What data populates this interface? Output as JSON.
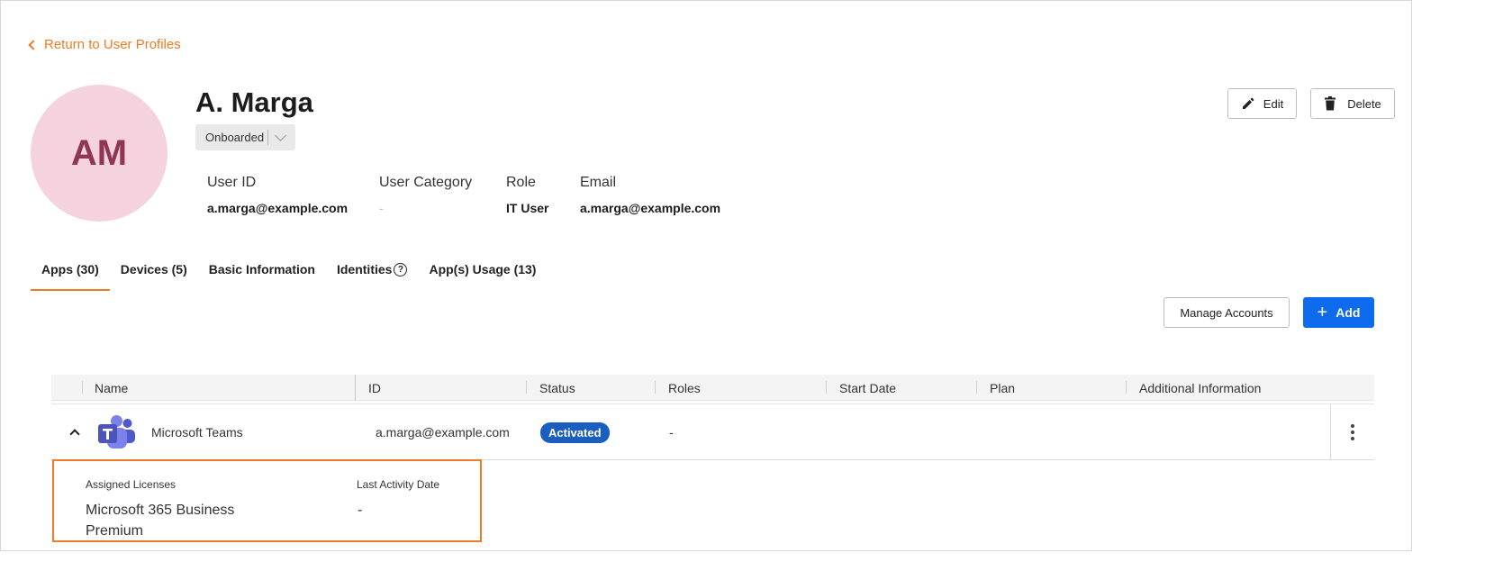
{
  "back_link": "Return to User Profiles",
  "profile": {
    "initials": "AM",
    "name": "A. Marga",
    "status": "Onboarded"
  },
  "actions": {
    "edit": "Edit",
    "delete": "Delete"
  },
  "info": {
    "user_id_label": "User ID",
    "user_id_value": "a.marga@example.com",
    "category_label": "User Category",
    "category_value": "-",
    "role_label": "Role",
    "role_value": "IT User",
    "email_label": "Email",
    "email_value": "a.marga@example.com"
  },
  "tabs": [
    {
      "label": "Apps (30)",
      "active": true
    },
    {
      "label": "Devices (5)"
    },
    {
      "label": "Basic Information"
    },
    {
      "label": "Identities"
    },
    {
      "label": "App(s) Usage (13)"
    }
  ],
  "table_actions": {
    "manage_accounts": "Manage Accounts",
    "add": "Add"
  },
  "table": {
    "columns": [
      "Name",
      "ID",
      "Status",
      "Roles",
      "Start Date",
      "Plan",
      "Additional Information"
    ],
    "rows": [
      {
        "name": "Microsoft Teams",
        "id": "a.marga@example.com",
        "status": "Activated",
        "roles": "-",
        "icon": "microsoft-teams-icon"
      }
    ]
  },
  "detail": {
    "licenses_label": "Assigned Licenses",
    "licenses_value_line1": "Microsoft 365 Business",
    "licenses_value_line2": "Premium",
    "activity_label": "Last Activity Date",
    "activity_value": "-"
  },
  "colors": {
    "accent_orange": "#ef7b26",
    "primary_blue": "#0f6bed",
    "badge_blue": "#1a5fbf",
    "avatar_bg": "#f5d3de",
    "avatar_text": "#8e3654"
  }
}
